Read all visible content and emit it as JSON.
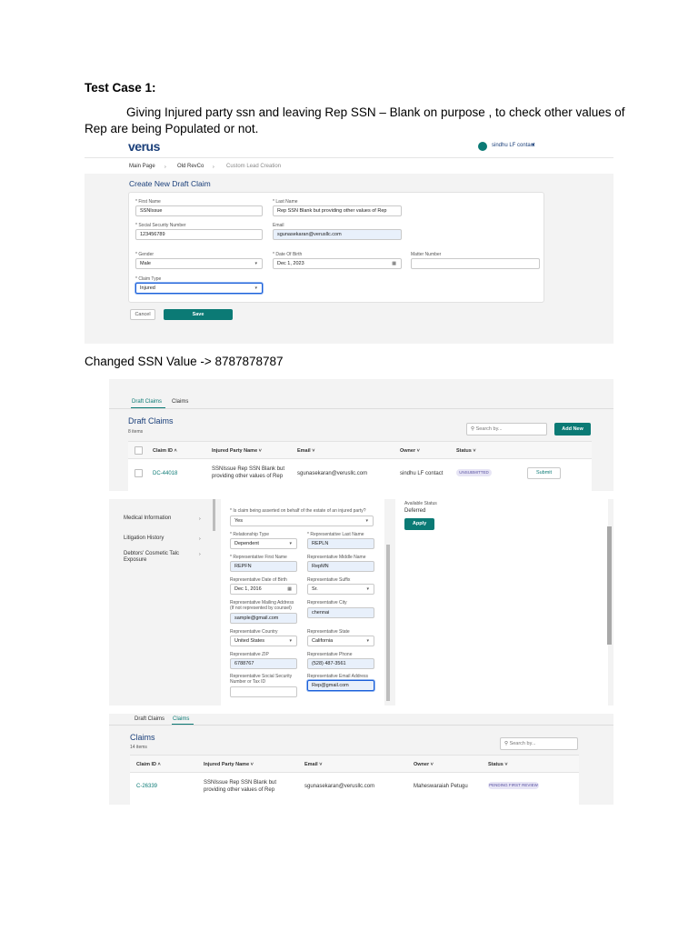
{
  "heading": "Test Case 1:",
  "intro_line1": "Giving Injured party ssn and leaving Rep SSN – Blank on purpose , to check other values of",
  "intro_line2": "Rep are being Populated or not.",
  "changed_ssn_text": "Changed SSN Value -> 8787878787",
  "shot1": {
    "logo": "verus",
    "user": "sindhu LF contact",
    "breadcrumbs": [
      "Main Page",
      "Old RevCo",
      "Custom Lead Creation"
    ],
    "form_title": "Create New Draft Claim",
    "first_name_label": "* First Name",
    "first_name_value": "SSNIssue",
    "last_name_label": "* Last Name",
    "last_name_value": "Rep SSN Blank but providing other values of Rep",
    "ssn_label": "* Social Security Number",
    "ssn_value": "123456789",
    "email_label": "Email",
    "email_value": "sgunasekaran@verusllc.com",
    "gender_label": "* Gender",
    "gender_value": "Male",
    "dob_label": "* Date Of Birth",
    "dob_value": "Dec 1, 2023",
    "matter_label": "Matter Number",
    "claim_type_label": "* Claim Type",
    "claim_type_value": "Injured",
    "cancel_label": "Cancel",
    "save_label": "Save"
  },
  "shot2": {
    "tabs": [
      "Draft Claims",
      "Claims"
    ],
    "title": "Draft Claims",
    "count": "8 items",
    "search_placeholder": "Search by...",
    "add_new": "Add New",
    "columns": [
      "Claim ID",
      "Injured Party Name",
      "Email",
      "Owner",
      "Status"
    ],
    "row": {
      "claim_id": "DC-44018",
      "party_line1": "SSNIssue Rep SSN Blank but",
      "party_line2": "providing other values of Rep",
      "email": "sgunasekaran@verusllc.com",
      "owner": "sindhu LF contact",
      "status": "UNSUBMITTED",
      "submit": "Submit"
    }
  },
  "shot3": {
    "nav": [
      "Medical Information",
      "Litigation History",
      "Debtors' Cosmetic Talc",
      "Exposure"
    ],
    "estate_question": "* Is claim being asserted on behalf of the estate of an injured party?",
    "estate_value": "Yes",
    "relationship_label": "* Relationship Type",
    "relationship_value": "Dependent",
    "rep_last_label": "* Representative Last Name",
    "rep_last_value": "REPLN",
    "rep_first_label": "* Representative First Name",
    "rep_first_value": "REPFN",
    "rep_middle_label": "Representative Middle Name",
    "rep_middle_value": "RepMN",
    "rep_dob_label": "Representative Date of Birth",
    "rep_dob_value": "Dec 1, 2016",
    "rep_suffix_label": "Representative Suffix",
    "rep_suffix_value": "Sr.",
    "mailing_label1": "Representative Mailing Address",
    "mailing_label2": "(If not represented by counsel)",
    "mailing_value": "sample@gmail.com",
    "city_label": "Representative City",
    "city_value": "chennai",
    "country_label": "Representative Country",
    "country_value": "United States",
    "state_label": "Representative State",
    "state_value": "California",
    "zip_label": "Representative ZIP",
    "zip_value": "6788767",
    "phone_label": "Representative Phone",
    "phone_value": "(528) 487-3561",
    "ssn_label1": "Representative Social Security",
    "ssn_label2": "Number or Tax ID",
    "rep_email_label": "Representative Email Address",
    "rep_email_value": "Rep@gmail.com",
    "available_status_label": "Available Status",
    "available_status_value": "Deferred",
    "apply": "Apply"
  },
  "shot4": {
    "tabs": [
      "Draft Claims",
      "Claims"
    ],
    "title": "Claims",
    "count": "14 items",
    "search_placeholder": "Search by...",
    "columns": [
      "Claim ID",
      "Injured Party Name",
      "Email",
      "Owner",
      "Status"
    ],
    "row": {
      "claim_id": "C-26339",
      "party_line1": "SSNIssue Rep SSN Blank but",
      "party_line2": "providing other values of Rep",
      "email": "sgunasekaran@verusllc.com",
      "owner": "Maheswaraiah Petugu",
      "status": "PENDING FIRST REVIEW"
    }
  },
  "colors": {
    "teal": "#0b7a75",
    "link": "#0b7a75",
    "navy": "#1a3f7a"
  }
}
